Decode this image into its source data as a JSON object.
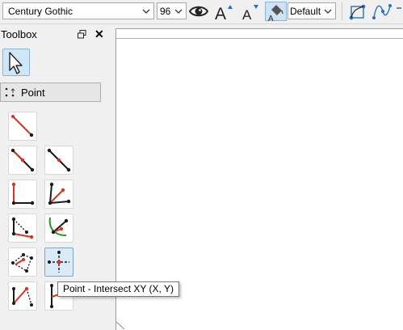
{
  "toolbar": {
    "font_family": "Century Gothic",
    "font_size": "96",
    "label_style": "Default",
    "icons": [
      "eye-icon",
      "increase-font-icon",
      "decrease-font-icon",
      "label-color-icon",
      "spline-icon",
      "curve-icon"
    ]
  },
  "toolbox": {
    "title": "Toolbox",
    "close_glyph": "✕",
    "group_label": "Point",
    "tooltip": "Point - Intersect XY (X, Y)"
  },
  "colors": {
    "accent_red": "#e0301e",
    "line_black": "#1a1a1a",
    "arc_green": "#1c9a1c",
    "selection_blue": "#cfe6f7"
  }
}
